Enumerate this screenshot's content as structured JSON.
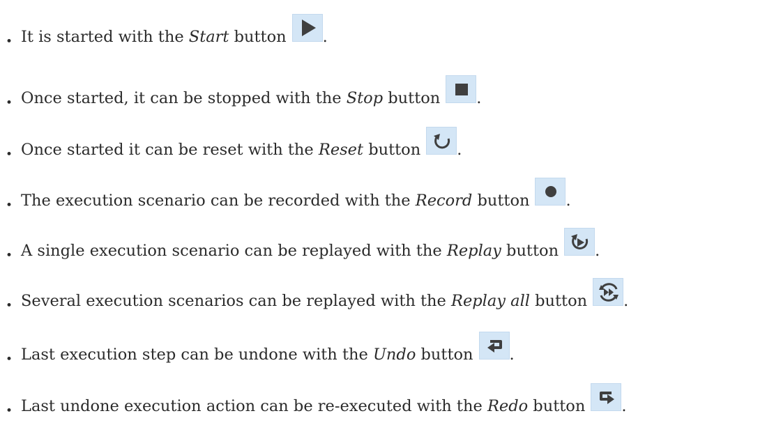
{
  "items": [
    {
      "pre": "It is started with the ",
      "name": "Start",
      "post": " button",
      "end": ".",
      "icon": "play-icon"
    },
    {
      "pre": "Once started, it can be stopped with the ",
      "name": "Stop",
      "post": " button",
      "end": ".",
      "icon": "stop-icon"
    },
    {
      "pre": "Once started it can be reset with the ",
      "name": "Reset",
      "post": " button",
      "end": ".",
      "icon": "reset-icon"
    },
    {
      "pre": "The execution scenario can be recorded with the ",
      "name": "Record",
      "post": " button",
      "end": ".",
      "icon": "record-icon"
    },
    {
      "pre": "A single execution scenario can be replayed with the ",
      "name": "Replay",
      "post": " button",
      "end": ".",
      "icon": "replay-icon"
    },
    {
      "pre": "Several execution scenarios can be replayed with the ",
      "name": "Replay all",
      "post": " button",
      "end": ".",
      "icon": "replay-all-icon"
    },
    {
      "pre": "Last execution step can be undone with the ",
      "name": "Undo",
      "post": " button",
      "end": ".",
      "icon": "undo-icon"
    },
    {
      "pre": "Last undone execution action can be re-executed with the ",
      "name": "Redo",
      "post": " button",
      "end": ".",
      "icon": "redo-icon"
    }
  ],
  "colors": {
    "text": "#2b2b2b",
    "button_bg": "#d4e6f6",
    "glyph": "#3a3a3a"
  }
}
